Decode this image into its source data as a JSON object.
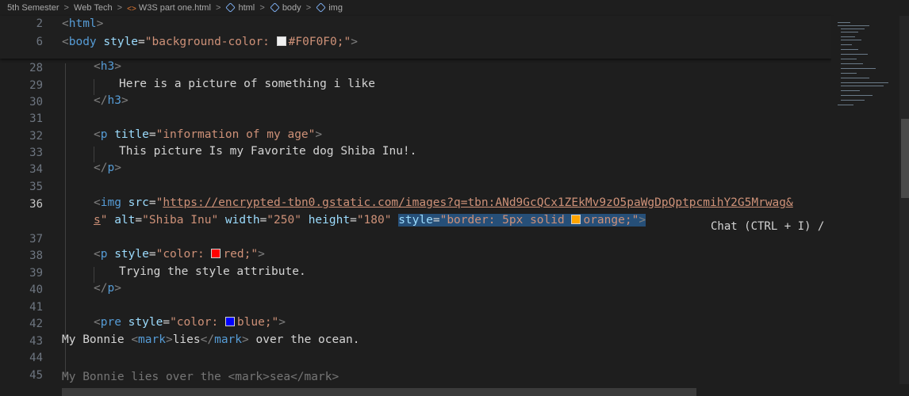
{
  "breadcrumb": {
    "items": [
      "5th Semester",
      "Web Tech",
      "W3S part one.html",
      "html",
      "body",
      "img"
    ],
    "separator": ">"
  },
  "sticky_lines": [
    {
      "number": "2",
      "tag": "html"
    },
    {
      "number": "6",
      "tag": "body",
      "attr": "style",
      "value_prefix": "\"background-color: ",
      "swatch_color": "#F0F0F0",
      "value_rest": "#F0F0F0;\""
    }
  ],
  "lines": {
    "n28": "28",
    "n29": "29",
    "n30": "30",
    "n31": "31",
    "n32": "32",
    "n33": "33",
    "n34": "34",
    "n35": "35",
    "n36": "36",
    "n37": "37",
    "n38": "38",
    "n39": "39",
    "n40": "40",
    "n41": "41",
    "n42": "42",
    "n43": "43",
    "n44": "44",
    "n45": "45",
    "h3_open": "h3",
    "h3_text": "Here is a picture of something i like",
    "h3_close": "h3",
    "p_tag": "p",
    "p_title_attr": "title",
    "p_title_val": "\"information of my age\"",
    "p_text": "This picture Is my Favorite dog Shiba Inu!.",
    "img_tag": "img",
    "src_attr": "src",
    "src_q1": "\"",
    "src_url": "https://encrypted-tbn0.gstatic.com/images?q=tbn:ANd9GcQCx1ZEkMv9zO5paWgDpQptpcmihY2G5Mrwag&",
    "src_url2": "s",
    "src_q2": "\"",
    "alt_attr": "alt",
    "alt_val": "\"Shiba Inu\"",
    "width_attr": "width",
    "width_val": "\"250\"",
    "height_attr": "height",
    "height_val": "\"180\"",
    "style_attr": "style",
    "style_val_a": "\"border: 5px solid ",
    "style_val_b": "orange;\"",
    "p2_style_val_a": "\"color: ",
    "p2_style_val_b": "red;\"",
    "p2_text": "Trying the style attribute.",
    "pre_tag": "pre",
    "pre_style_val_a": "\"color: ",
    "pre_style_val_b": "blue;\"",
    "pre_text_a": "My Bonnie ",
    "mark_tag": "mark",
    "mark_text": "lies",
    "pre_text_b": " over the ocean.",
    "line45_text": "My Bonnie lies over the <mark>sea</mark>"
  },
  "colors": {
    "swatch_f0": "#F0F0F0",
    "swatch_orange": "#FFA500",
    "swatch_red": "#FF0000",
    "swatch_blue": "#0000FF"
  },
  "chat_hint": "Chat (CTRL + I) /"
}
